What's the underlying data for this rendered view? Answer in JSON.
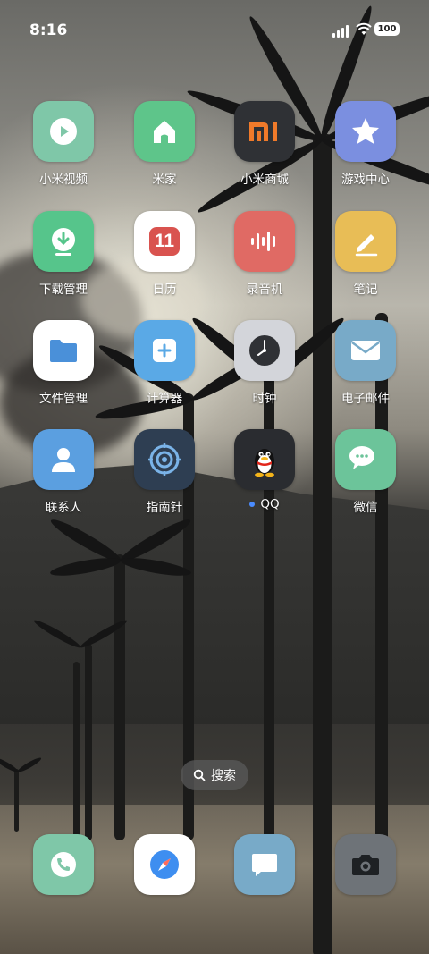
{
  "status_bar": {
    "time": "8:16",
    "battery": "100"
  },
  "apps": [
    {
      "label": "小米视频",
      "icon": "play-icon",
      "color": "#7fc7a8"
    },
    {
      "label": "米家",
      "icon": "home-icon",
      "color": "#5ec58a"
    },
    {
      "label": "小米商城",
      "icon": "mi-logo-icon",
      "color": "#2f3135"
    },
    {
      "label": "游戏中心",
      "icon": "star-icon",
      "color": "#7b8fe0"
    },
    {
      "label": "下载管理",
      "icon": "download-icon",
      "color": "#56c58b"
    },
    {
      "label": "日历",
      "icon": "calendar-icon",
      "calendar_day": "11",
      "color": "#ffffff"
    },
    {
      "label": "录音机",
      "icon": "sound-wave-icon",
      "color": "#e06a64"
    },
    {
      "label": "笔记",
      "icon": "pencil-icon",
      "color": "#e8bd56"
    },
    {
      "label": "文件管理",
      "icon": "folder-icon",
      "color": "#ffffff"
    },
    {
      "label": "计算器",
      "icon": "calculator-icon",
      "color": "#5aa9e6"
    },
    {
      "label": "时钟",
      "icon": "clock-icon",
      "color": "#d3d5da"
    },
    {
      "label": "电子邮件",
      "icon": "mail-icon",
      "color": "#78aac8"
    },
    {
      "label": "联系人",
      "icon": "contact-icon",
      "color": "#5b9fe0"
    },
    {
      "label": "指南针",
      "icon": "compass-icon",
      "color": "#2e3e52"
    },
    {
      "label": "QQ",
      "icon": "qq-penguin-icon",
      "color": "#2a2c30",
      "new_dot": true
    },
    {
      "label": "微信",
      "icon": "wechat-icon",
      "color": "#6cc49a"
    }
  ],
  "search": {
    "label": "搜索"
  },
  "dock": [
    {
      "name": "phone",
      "icon": "phone-icon",
      "color": "#7fc7a8"
    },
    {
      "name": "browser",
      "icon": "browser-compass-icon",
      "color": "#ffffff"
    },
    {
      "name": "messages",
      "icon": "message-icon",
      "color": "#78aac8"
    },
    {
      "name": "camera",
      "icon": "camera-icon",
      "color": "#6e7378"
    }
  ]
}
